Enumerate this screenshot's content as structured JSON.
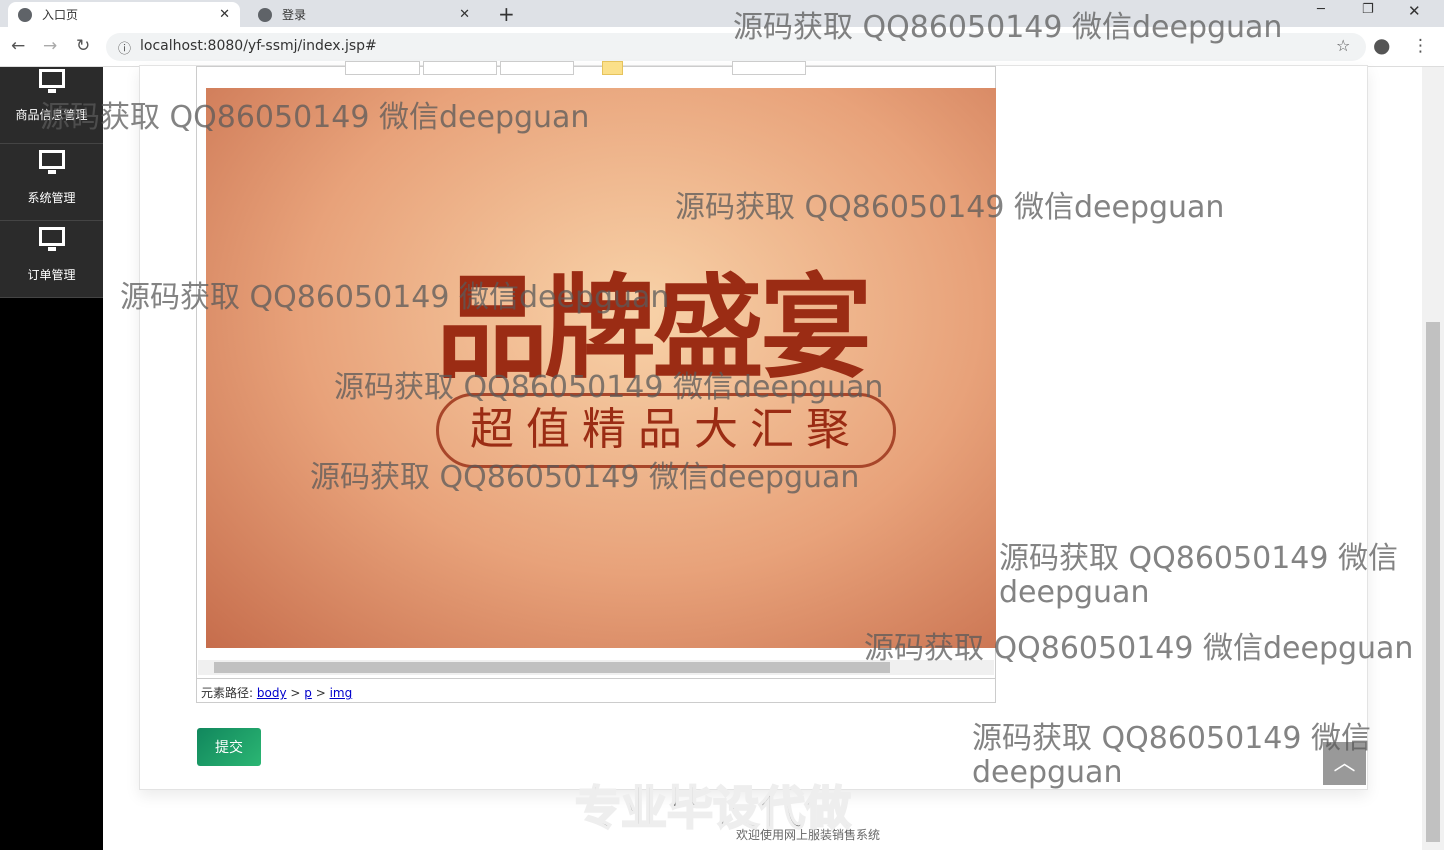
{
  "browser": {
    "tabs": [
      {
        "label": "入口页",
        "active": true
      },
      {
        "label": "登录",
        "active": false
      }
    ],
    "url": "localhost:8080/yf-ssmj/index.jsp#"
  },
  "sidebar": {
    "items": [
      {
        "label": "商品信息管理"
      },
      {
        "label": "系统管理"
      },
      {
        "label": "订单管理"
      }
    ]
  },
  "editor": {
    "banner_title": "品牌盛宴",
    "banner_subtitle": "超值精品大汇聚",
    "path_label": "元素路径:",
    "path": [
      "body",
      "p",
      "img"
    ]
  },
  "form": {
    "submit_label": "提交"
  },
  "footer": {
    "text": "欢迎使用网上服装销售系统"
  },
  "watermark": {
    "text": "源码获取 QQ86050149 微信deepguan",
    "banner": "专业毕设代做"
  }
}
